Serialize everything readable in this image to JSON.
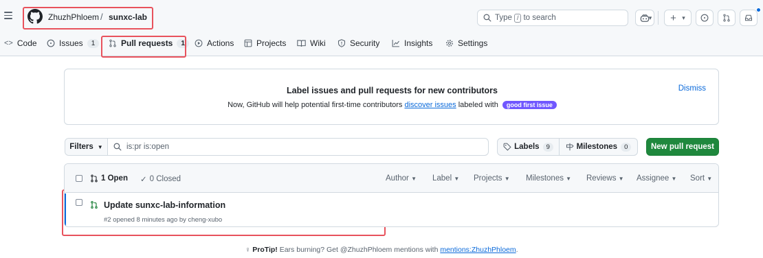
{
  "header": {
    "owner": "ZhuzhPhloem",
    "separator": "/",
    "repo": "sunxc-lab",
    "search": {
      "prefix": "Type",
      "key": "/",
      "suffix": "to search"
    },
    "copilot_caret": "▾",
    "create_plus": "+",
    "create_caret": "▾"
  },
  "tabs": [
    {
      "label": "Code"
    },
    {
      "label": "Issues",
      "count": "1"
    },
    {
      "label": "Pull requests",
      "count": "1"
    },
    {
      "label": "Actions"
    },
    {
      "label": "Projects"
    },
    {
      "label": "Wiki"
    },
    {
      "label": "Security"
    },
    {
      "label": "Insights"
    },
    {
      "label": "Settings"
    }
  ],
  "banner": {
    "title": "Label issues and pull requests for new contributors",
    "text_before": "Now, GitHub will help potential first-time contributors",
    "link": "discover issues",
    "text_after": "labeled with",
    "label": "good first issue",
    "dismiss": "Dismiss"
  },
  "filters": {
    "button": "Filters",
    "query": "is:pr is:open"
  },
  "labels": {
    "label": "Labels",
    "count": "9"
  },
  "milestones": {
    "label": "Milestones",
    "count": "0"
  },
  "new_pr": "New pull request",
  "list": {
    "open": "1 Open",
    "closed": "0 Closed",
    "sort_menus": [
      "Author",
      "Label",
      "Projects",
      "Milestones",
      "Reviews",
      "Assignee",
      "Sort"
    ],
    "items": [
      {
        "title": "Update sunxc-lab-information",
        "meta": "#2 opened 8 minutes ago by cheng-xubo"
      }
    ]
  },
  "protip": {
    "lead": "ProTip!",
    "text": "Ears burning? Get @ZhuzhPhloem mentions with",
    "link": "mentions:ZhuzhPhloem",
    "end": "."
  },
  "colors": {
    "accent": "#0969da",
    "success": "#1f883d",
    "open_icon": "#1a7f37",
    "label_good_first_issue": "#7057ff",
    "annotation": "#e8525c"
  }
}
